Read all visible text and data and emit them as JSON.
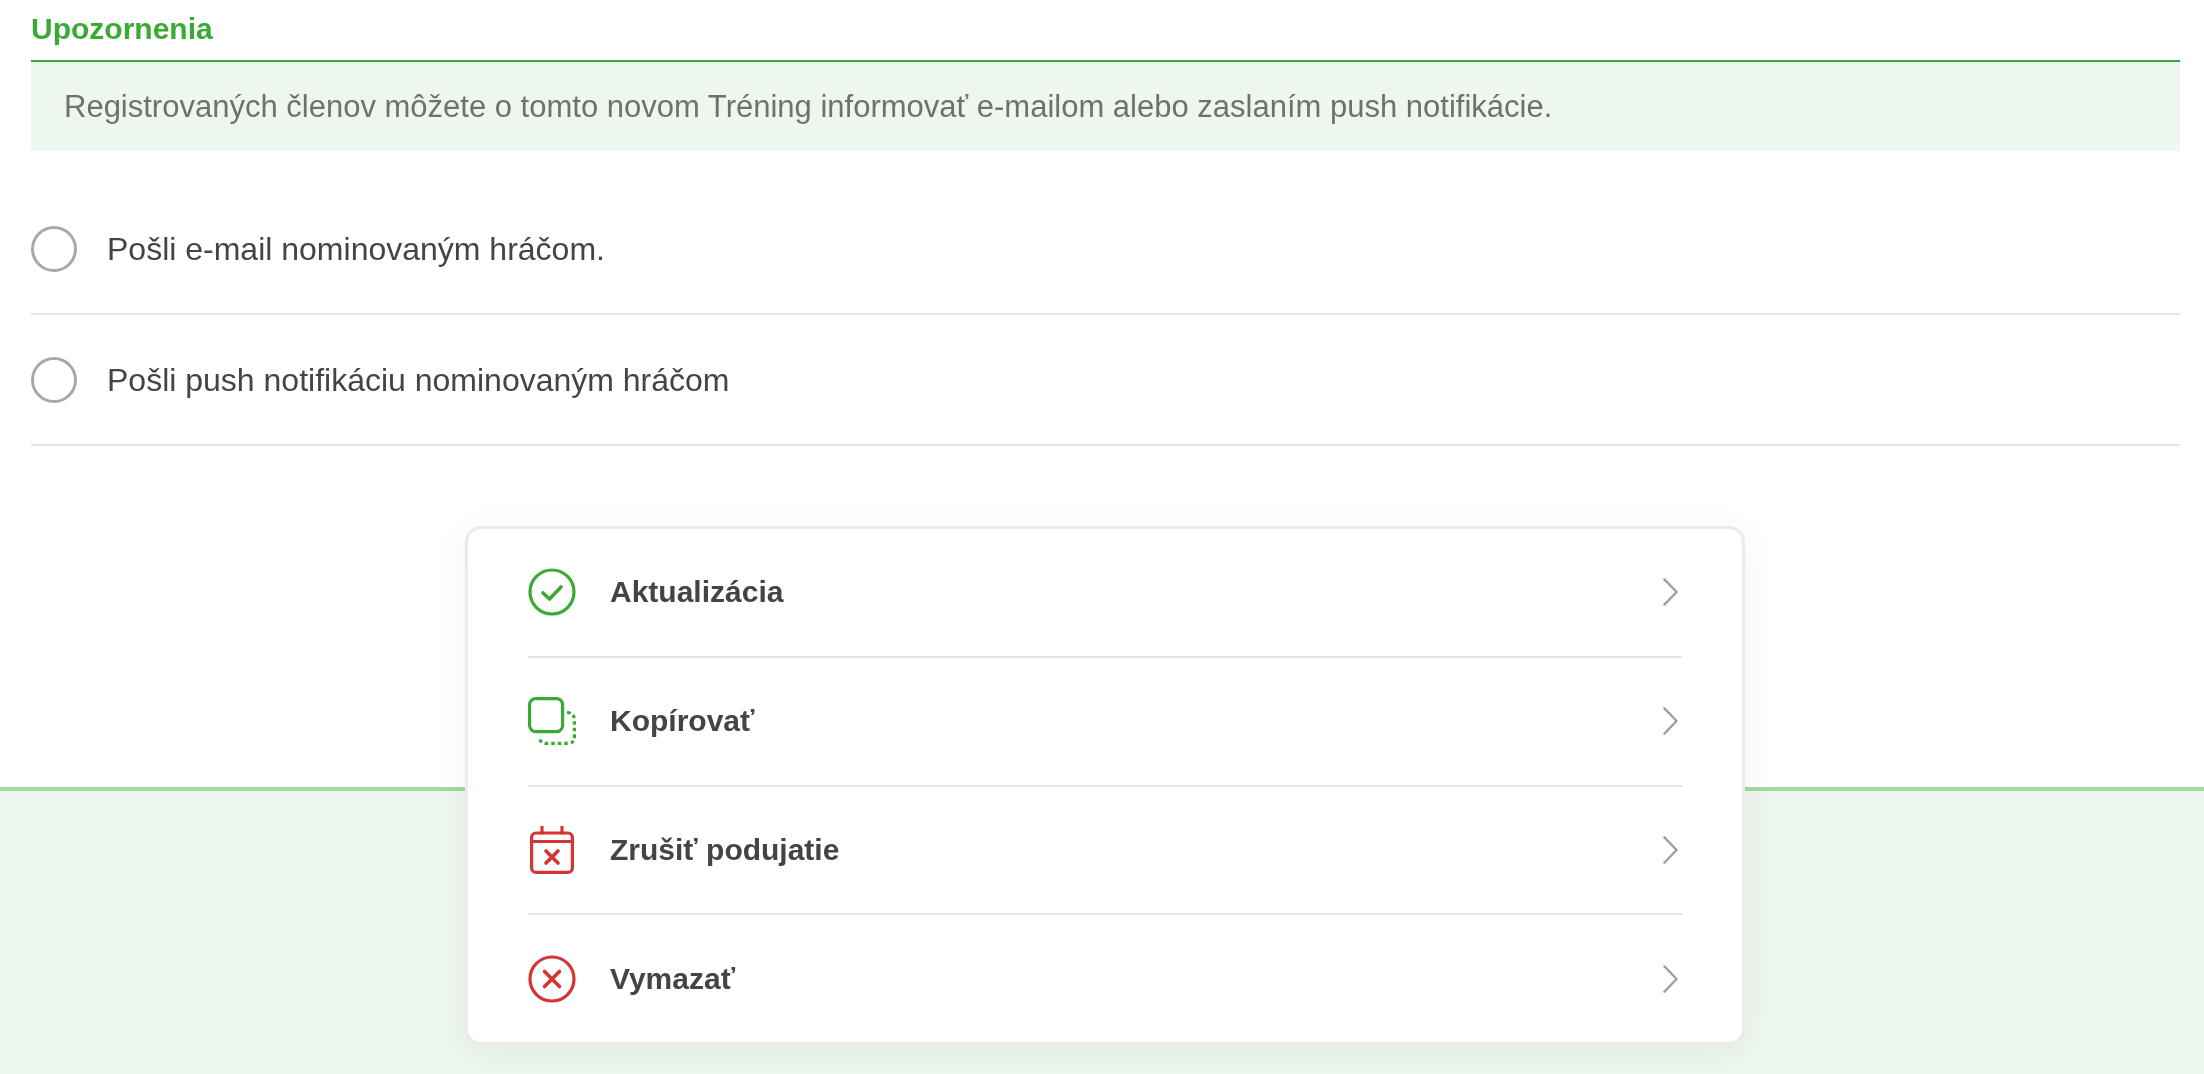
{
  "section": {
    "title": "Upozornenia",
    "info": "Registrovaných členov môžete o tomto novom Tréning informovať e-mailom alebo zaslaním push notifikácie."
  },
  "options": [
    {
      "label": "Pošli e-mail nominovaným hráčom.",
      "selected": false
    },
    {
      "label": "Pošli push notifikáciu nominovaným hráčom",
      "selected": false
    }
  ],
  "action_menu": {
    "items": [
      {
        "kind": "update",
        "label": "Aktualizácia"
      },
      {
        "kind": "copy",
        "label": "Kopírovať"
      },
      {
        "kind": "cancel",
        "label": "Zrušiť podujatie"
      },
      {
        "kind": "delete",
        "label": "Vymazať"
      }
    ]
  }
}
